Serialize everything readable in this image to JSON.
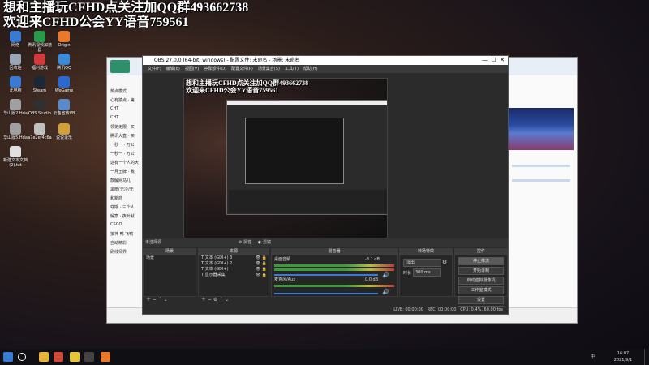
{
  "overlay": {
    "line1": "想和主播玩CFHD点关注加QQ群493662738",
    "line2": "欢迎来CFHD公会YY语音759561"
  },
  "desktop_icons": [
    {
      "label": "网络",
      "color": "#3a7ad0"
    },
    {
      "label": "腾讯视频加速器",
      "color": "#2a9a4a"
    },
    {
      "label": "Origin",
      "color": "#e8782a"
    },
    {
      "label": "回收站",
      "color": "#9aa6b8"
    },
    {
      "label": "福利游戏",
      "color": "#d03a3a"
    },
    {
      "label": "腾讯QQ",
      "color": "#3a8ad8"
    },
    {
      "label": "此电脑",
      "color": "#3a7ad0"
    },
    {
      "label": "Steam",
      "color": "#1b2838"
    },
    {
      "label": "WeGame",
      "color": "#2a6ad0"
    },
    {
      "label": "华山版2.Hda",
      "color": "#a0a0a0"
    },
    {
      "label": "OBS Studio",
      "color": "#303030"
    },
    {
      "label": "云备宣传VB",
      "color": "#5a8ac8"
    },
    {
      "label": "华山版5.Hda",
      "color": "#a0a0a0"
    },
    {
      "label": "a7e2ef4c6a",
      "color": "#c0c0c0"
    },
    {
      "label": "说说录乐",
      "color": "#d0a03a"
    },
    {
      "label": "新建文本文档(2).txt",
      "color": "#e0e0e0"
    }
  ],
  "bg_app": {
    "title_hint": "热点模式",
    "list": [
      "热点模式",
      "心有猿点 · 第",
      "CHT",
      "CHT",
      "领第无限 · 买",
      "腾讯大直 · 买",
      "一秒一 · 万公",
      "一秒一 · 万公",
      "这有一个人的大",
      "一月王牌 · 我",
      "款解网马儿",
      "黑暗(无冷/无",
      "和新商",
      "夺期 · 三个人",
      "解案 · 夜叶就",
      "CSGO",
      "狼神·鸭·飞鸭",
      "自动精彩",
      "刷线师界"
    ]
  },
  "obs": {
    "title": "OBS 27.0.0 (64-bit, windows) - 配置文件: 未命名 - 场景: 未命名",
    "menu": [
      "文件(F)",
      "编辑(E)",
      "视图(V)",
      "停靠部件(D)",
      "配置文件(P)",
      "场景集合(S)",
      "工具(T)",
      "帮助(H)"
    ],
    "preview_overlay1": "想和主播玩CFHD点关注加QQ群493662738",
    "preview_overlay2": "欢迎来CFHD公会YY语音759561",
    "scene_bar": "未选择源",
    "scene_bar_props": "属性",
    "scene_bar_filters": "滤镜",
    "panels": {
      "scenes": "场景",
      "sources": "来源",
      "mixer": "混音器",
      "transitions": "转场特效",
      "controls": "控件"
    },
    "scene_list": [
      "场景"
    ],
    "sources": [
      "文本 (GDI+) 3",
      "文本 (GDI+) 2",
      "文本 (GDI+)",
      "显示器采集"
    ],
    "mixer": [
      {
        "name": "桌面音频",
        "db": "-8.1 dB"
      },
      {
        "name": "麦克风/Aux",
        "db": "0.0 dB"
      }
    ],
    "transition": {
      "type": "淡出",
      "duration_label": "时长",
      "duration": "300 ms"
    },
    "controls": [
      "停止推流",
      "开始录制",
      "启动虚拟摄像机",
      "工作室模式",
      "设置",
      "退出"
    ],
    "status": {
      "live": "LIVE: 00:00:00",
      "rec": "REC: 00:00:00",
      "cpu": "CPU: 0.4%, 60.00 fps"
    }
  },
  "taskbar": {
    "time": "16:07",
    "date": "2021/9/1",
    "lang": "中",
    "icons": [
      {
        "name": "windows",
        "color": "#3a7ad0"
      },
      {
        "name": "search",
        "color": "#ffffff"
      },
      {
        "name": "file-explorer",
        "color": "#e8b43a"
      },
      {
        "name": "google-chrome",
        "color": "#d04a3a"
      },
      {
        "name": "yy-voice",
        "color": "#e8c43a"
      },
      {
        "name": "obs",
        "color": "#444444"
      },
      {
        "name": "app-orange",
        "color": "#e8782a"
      }
    ]
  }
}
